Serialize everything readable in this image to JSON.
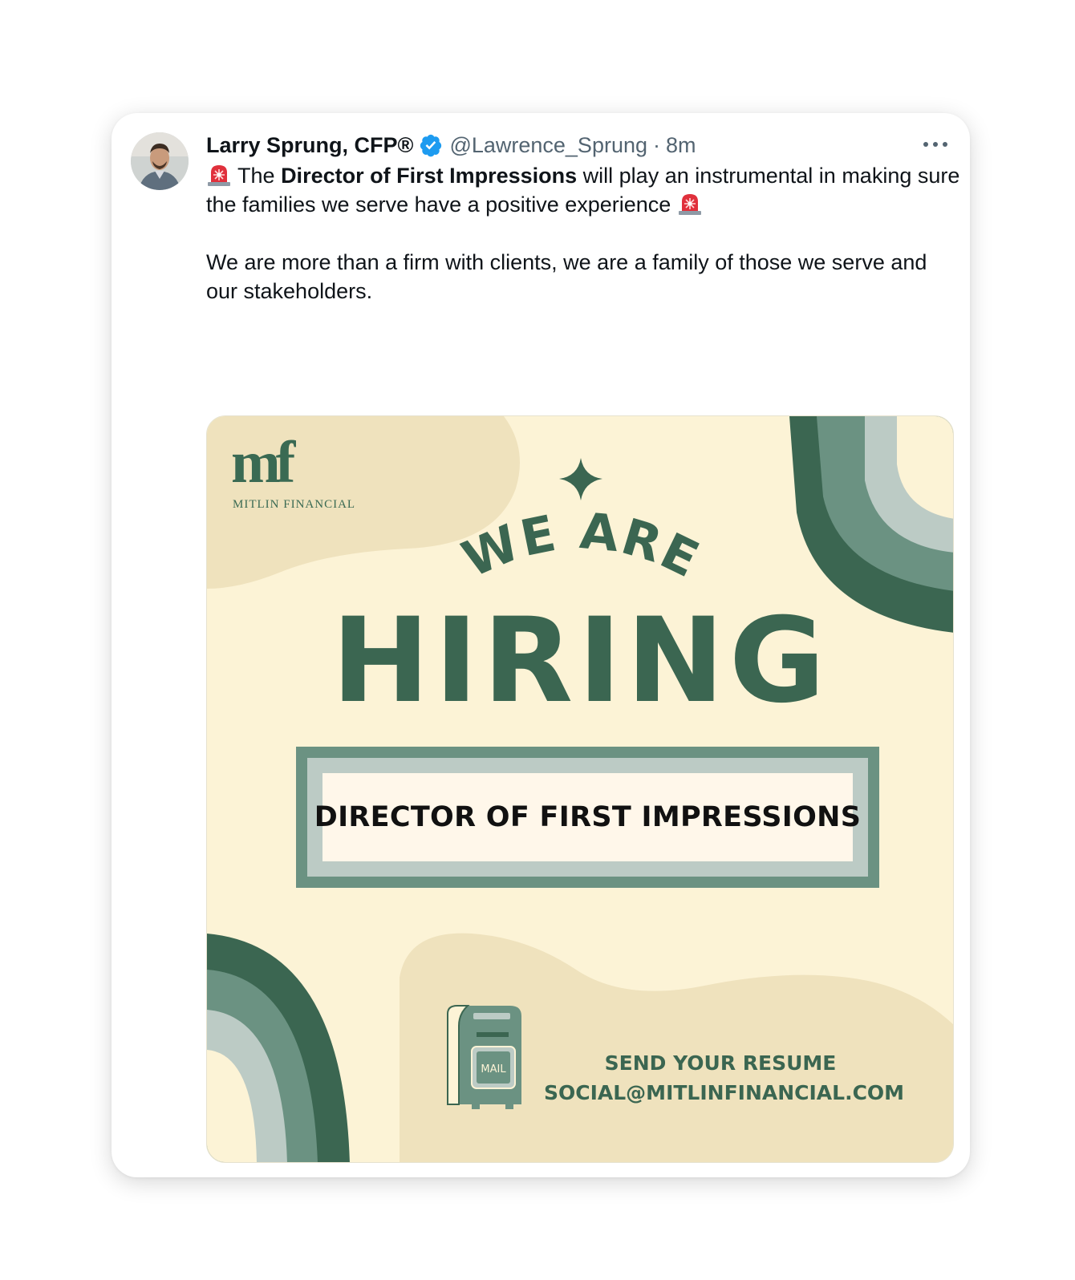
{
  "tweet": {
    "author_name": "Larry Sprung, CFP®",
    "handle": "@Lawrence_Sprung",
    "separator": "·",
    "time": "8m",
    "more_label": "More",
    "text": {
      "line1_prefix": "The",
      "line1_bold": "Director of First Impressions",
      "line1_suffix": "will play an instrumental in making sure the families we serve have a positive experience",
      "paragraph2": "We are more than a firm with clients, we are a family of those we serve and our stakeholders."
    }
  },
  "image": {
    "logo_mark": "mf",
    "logo_left": "MITLIN",
    "logo_right": "FINANCIAL",
    "headline_top": "WE ARE",
    "headline_main": "HIRING",
    "role": "DIRECTOR OF FIRST IMPRESSIONS",
    "mailbox_label": "MAIL",
    "cta_line1": "SEND YOUR RESUME",
    "cta_line2": "SOCIAL@MITLINFINANCIAL.COM"
  },
  "colors": {
    "background": "#fcf3d6",
    "blob": "#efe2bd",
    "green_dark": "#3b6651",
    "green_mid": "#6b9282",
    "green_light": "#bccbc5",
    "verified": "#1d9bf0",
    "text_secondary": "#536471"
  }
}
